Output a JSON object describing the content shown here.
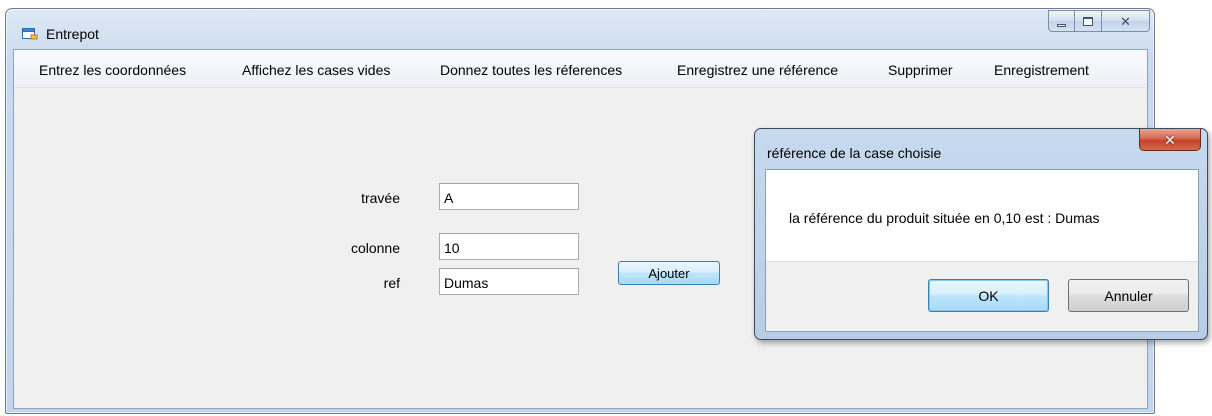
{
  "window": {
    "title": "Entrepot",
    "icon": "app-window-icon",
    "controls": [
      "minimize-icon",
      "maximize-icon",
      "close-icon"
    ]
  },
  "menu": {
    "items": [
      {
        "label": "Entrez les coordonnées"
      },
      {
        "label": "Affichez les cases vides"
      },
      {
        "label": "Donnez toutes les réferences"
      },
      {
        "label": "Enregistrez une référence"
      },
      {
        "label": "Supprimer"
      },
      {
        "label": "Enregistrement"
      }
    ]
  },
  "form": {
    "travee_label": "travée",
    "travee_value": "A",
    "colonne_label": "colonne",
    "colonne_value": "10",
    "ref_label": "ref",
    "ref_value": "Dumas",
    "add_button": "Ajouter"
  },
  "dialog": {
    "title": "référence de la case choisie",
    "message": "la référence du produit située en 0,10 est : Dumas",
    "ok_label": "OK",
    "cancel_label": "Annuler",
    "close_icon": "close-icon"
  },
  "colors": {
    "window_frame": "#c9daee",
    "client_background": "#f0f0f0",
    "dialog_close_red": "#c4432a",
    "default_button_blue": "#3c7fb1"
  }
}
